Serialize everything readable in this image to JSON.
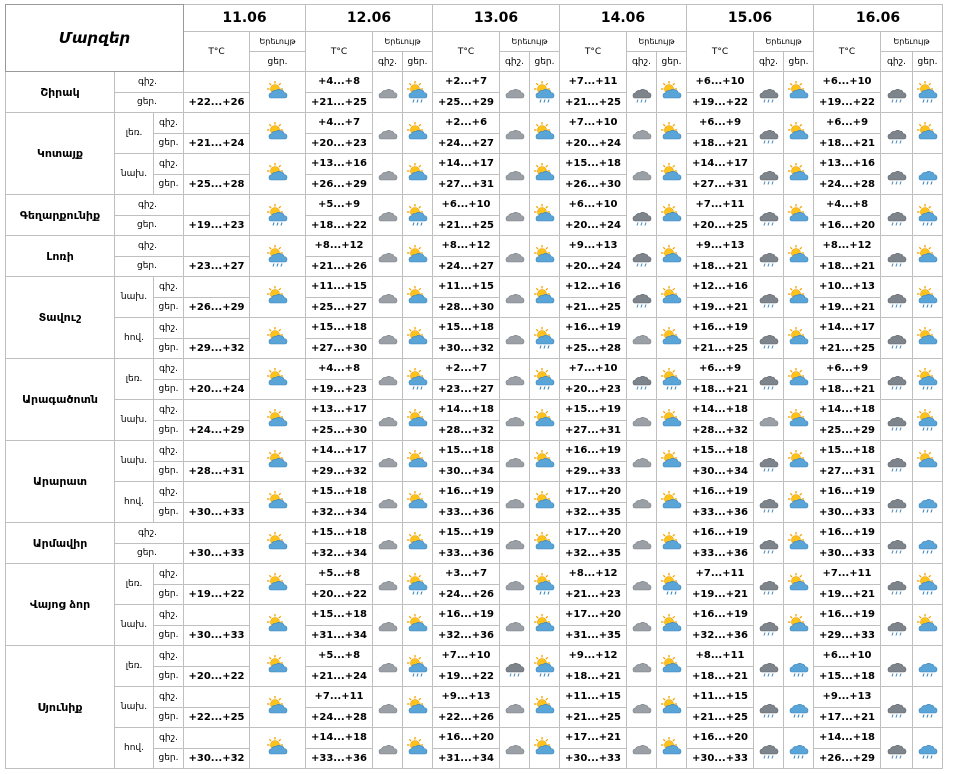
{
  "header": {
    "region_col": "Մարզեր",
    "temp_label": "T°C",
    "phen_label": "Երեւույթ",
    "night": "գիշ.",
    "day": "ցեր."
  },
  "days": [
    "11.06",
    "12.06",
    "13.06",
    "14.06",
    "15.06",
    "16.06"
  ],
  "regions": [
    {
      "name": "Շիրակ",
      "subs": [
        {
          "name": "",
          "nights": [
            "",
            "+4...+8",
            "+2...+7",
            "+7...+11",
            "+6...+10",
            "+6...+10"
          ],
          "days": [
            "+22...+26",
            "+21...+25",
            "+25...+29",
            "+21...+25",
            "+19...+22",
            "+19...+22"
          ]
        }
      ]
    },
    {
      "name": "Կոտայք",
      "subs": [
        {
          "name": "լեռ.",
          "nights": [
            "",
            "+4...+7",
            "+2...+6",
            "+7...+10",
            "+6...+9",
            "+6...+9"
          ],
          "days": [
            "+21...+24",
            "+20...+23",
            "+24...+27",
            "+20...+24",
            "+18...+21",
            "+18...+21"
          ]
        },
        {
          "name": "նախ.",
          "nights": [
            "",
            "+13...+16",
            "+14...+17",
            "+15...+18",
            "+14...+17",
            "+13...+16"
          ],
          "days": [
            "+25...+28",
            "+26...+29",
            "+27...+31",
            "+26...+30",
            "+27...+31",
            "+24...+28"
          ]
        }
      ]
    },
    {
      "name": "Գեղարքունիք",
      "subs": [
        {
          "name": "",
          "nights": [
            "",
            "+5...+9",
            "+6...+10",
            "+6...+10",
            "+7...+11",
            "+4...+8"
          ],
          "days": [
            "+19...+23",
            "+18...+22",
            "+21...+25",
            "+20...+24",
            "+20...+25",
            "+16...+20"
          ]
        }
      ]
    },
    {
      "name": "Լոռի",
      "subs": [
        {
          "name": "",
          "nights": [
            "",
            "+8...+12",
            "+8...+12",
            "+9...+13",
            "+9...+13",
            "+8...+12"
          ],
          "days": [
            "+23...+27",
            "+21...+26",
            "+24...+27",
            "+20...+24",
            "+18...+21",
            "+18...+21"
          ]
        }
      ]
    },
    {
      "name": "Տավուշ",
      "subs": [
        {
          "name": "նախ.",
          "nights": [
            "",
            "+11...+15",
            "+11...+15",
            "+12...+16",
            "+12...+16",
            "+10...+13"
          ],
          "days": [
            "+26...+29",
            "+25...+27",
            "+28...+30",
            "+21...+25",
            "+19...+21",
            "+19...+21"
          ]
        },
        {
          "name": "հով.",
          "nights": [
            "",
            "+15...+18",
            "+15...+18",
            "+16...+19",
            "+16...+19",
            "+14...+17"
          ],
          "days": [
            "+29...+32",
            "+27...+30",
            "+30...+32",
            "+25...+28",
            "+21...+25",
            "+21...+25"
          ]
        }
      ]
    },
    {
      "name": "Արագածոտն",
      "subs": [
        {
          "name": "լեռ.",
          "nights": [
            "",
            "+4...+8",
            "+2...+7",
            "+7...+10",
            "+6...+9",
            "+6...+9"
          ],
          "days": [
            "+20...+24",
            "+19...+23",
            "+23...+27",
            "+20...+23",
            "+18...+21",
            "+18...+21"
          ]
        },
        {
          "name": "նախ.",
          "nights": [
            "",
            "+13...+17",
            "+14...+18",
            "+15...+19",
            "+14...+18",
            "+14...+18"
          ],
          "days": [
            "+24...+29",
            "+25...+30",
            "+28...+32",
            "+27...+31",
            "+28...+32",
            "+25...+29"
          ]
        }
      ]
    },
    {
      "name": "Արարատ",
      "subs": [
        {
          "name": "նախ.",
          "nights": [
            "",
            "+14...+17",
            "+15...+18",
            "+16...+19",
            "+15...+18",
            "+15...+18"
          ],
          "days": [
            "+28...+31",
            "+29...+32",
            "+30...+34",
            "+29...+33",
            "+30...+34",
            "+27...+31"
          ]
        },
        {
          "name": "հով.",
          "nights": [
            "",
            "+15...+18",
            "+16...+19",
            "+17...+20",
            "+16...+19",
            "+16...+19"
          ],
          "days": [
            "+30...+33",
            "+32...+34",
            "+33...+36",
            "+32...+35",
            "+33...+36",
            "+30...+33"
          ]
        }
      ]
    },
    {
      "name": "Արմավիր",
      "subs": [
        {
          "name": "",
          "nights": [
            "",
            "+15...+18",
            "+15...+19",
            "+17...+20",
            "+16...+19",
            "+16...+19"
          ],
          "days": [
            "+30...+33",
            "+32...+34",
            "+33...+36",
            "+32...+35",
            "+33...+36",
            "+30...+33"
          ]
        }
      ]
    },
    {
      "name": "Վայոց ձոր",
      "subs": [
        {
          "name": "լեռ.",
          "nights": [
            "",
            "+5...+8",
            "+3...+7",
            "+8...+12",
            "+7...+11",
            "+7...+11"
          ],
          "days": [
            "+19...+22",
            "+20...+22",
            "+24...+26",
            "+21...+23",
            "+19...+21",
            "+19...+21"
          ]
        },
        {
          "name": "նախ.",
          "nights": [
            "",
            "+15...+18",
            "+16...+19",
            "+17...+20",
            "+16...+19",
            "+16...+19"
          ],
          "days": [
            "+30...+33",
            "+31...+34",
            "+32...+36",
            "+31...+35",
            "+32...+36",
            "+29...+33"
          ]
        }
      ]
    },
    {
      "name": "Սյունիք",
      "subs": [
        {
          "name": "լեռ.",
          "nights": [
            "",
            "+5...+8",
            "+7...+10",
            "+9...+12",
            "+8...+11",
            "+6...+10"
          ],
          "days": [
            "+20...+22",
            "+21...+24",
            "+19...+22",
            "+18...+21",
            "+18...+21",
            "+15...+18"
          ]
        },
        {
          "name": "նախ.",
          "nights": [
            "",
            "+7...+11",
            "+9...+13",
            "+11...+15",
            "+11...+15",
            "+9...+13"
          ],
          "days": [
            "+22...+25",
            "+24...+28",
            "+22...+26",
            "+21...+25",
            "+21...+25",
            "+17...+21"
          ]
        },
        {
          "name": "հով.",
          "nights": [
            "",
            "+14...+18",
            "+16...+20",
            "+17...+21",
            "+16...+20",
            "+14...+18"
          ],
          "days": [
            "+30...+32",
            "+33...+36",
            "+31...+34",
            "+30...+33",
            "+30...+33",
            "+26...+29"
          ]
        }
      ]
    }
  ],
  "icons": {
    "shirak": {
      "n": [
        "",
        "cloud",
        "cloud",
        "dark-cloud",
        "dark-cloud",
        "dark-cloud"
      ],
      "d": [
        "sun-cloud",
        "sun-cloud-rain",
        "sun-cloud-rain",
        "sun-cloud",
        "sun-cloud",
        "sun-cloud-rain"
      ],
      "n2": [
        "",
        "sun-cloud-rain",
        "sun-cloud-rain",
        "sun-cloud",
        "sun-cloud",
        "sun-cloud-rain"
      ]
    },
    "kotayk_mtn": {
      "n": [
        "",
        "cloud",
        "cloud",
        "cloud",
        "dark-cloud",
        "dark-cloud"
      ],
      "d": [
        "sun-cloud",
        "sun-cloud",
        "sun-cloud",
        "sun-cloud",
        "sun-cloud",
        "sun-cloud"
      ]
    },
    "kotayk_plain": {
      "n": [
        "",
        "cloud",
        "cloud",
        "cloud",
        "dark-cloud",
        "dark-cloud"
      ],
      "d": [
        "sun-cloud",
        "sun-cloud",
        "sun-cloud",
        "sun-cloud",
        "sun-cloud",
        "rain-cloud"
      ]
    },
    "gegh": {
      "n": [
        "",
        "cloud",
        "cloud",
        "dark-cloud",
        "dark-cloud",
        "dark-cloud"
      ],
      "d": [
        "sun-cloud-rain",
        "sun-cloud-rain",
        "sun-cloud",
        "sun-cloud",
        "sun-cloud",
        "sun-cloud-rain"
      ]
    },
    "lori": {
      "n": [
        "",
        "cloud",
        "cloud",
        "dark-cloud",
        "dark-cloud",
        "dark-cloud"
      ],
      "d": [
        "sun-cloud-rain",
        "sun-cloud",
        "sun-cloud",
        "sun-cloud",
        "sun-cloud",
        "sun-cloud"
      ]
    },
    "tavush_plain": {
      "n": [
        "",
        "cloud",
        "cloud",
        "dark-cloud",
        "dark-cloud",
        "dark-cloud"
      ],
      "d": [
        "sun-cloud",
        "sun-cloud",
        "sun-cloud",
        "sun-cloud",
        "sun-cloud",
        "sun-cloud-rain"
      ]
    },
    "tavush_val": {
      "n": [
        "",
        "cloud",
        "cloud",
        "cloud",
        "dark-cloud",
        "dark-cloud"
      ],
      "d": [
        "sun-cloud",
        "sun-cloud",
        "sun-cloud-rain",
        "sun-cloud",
        "sun-cloud",
        "sun-cloud"
      ]
    },
    "arag_mtn": {
      "n": [
        "",
        "cloud",
        "cloud",
        "dark-cloud",
        "dark-cloud",
        "dark-cloud"
      ],
      "d": [
        "sun-cloud",
        "sun-cloud-rain",
        "sun-cloud-rain",
        "sun-cloud-rain",
        "sun-cloud",
        "sun-cloud-rain"
      ]
    },
    "arag_plain": {
      "n": [
        "",
        "cloud",
        "cloud",
        "cloud",
        "cloud",
        "dark-cloud"
      ],
      "d": [
        "sun-cloud",
        "sun-cloud",
        "sun-cloud",
        "sun-cloud",
        "sun-cloud",
        "sun-cloud-rain"
      ]
    },
    "ararat_plain": {
      "n": [
        "",
        "cloud",
        "cloud",
        "cloud",
        "dark-cloud",
        "dark-cloud"
      ],
      "d": [
        "sun-cloud",
        "sun-cloud",
        "sun-cloud",
        "sun-cloud",
        "sun-cloud",
        "sun-cloud"
      ]
    },
    "ararat_val": {
      "n": [
        "",
        "cloud",
        "cloud",
        "cloud",
        "dark-cloud",
        "dark-cloud"
      ],
      "d": [
        "sun-cloud",
        "sun-cloud",
        "sun-cloud",
        "sun-cloud",
        "sun-cloud",
        "rain-cloud"
      ]
    },
    "armavir": {
      "n": [
        "",
        "cloud",
        "cloud",
        "cloud",
        "dark-cloud",
        "dark-cloud"
      ],
      "d": [
        "sun-cloud",
        "sun-cloud",
        "sun-cloud",
        "sun-cloud",
        "sun-cloud",
        "rain-cloud"
      ]
    },
    "vayots_mtn": {
      "n": [
        "",
        "cloud",
        "cloud",
        "cloud",
        "dark-cloud",
        "dark-cloud"
      ],
      "d": [
        "sun-cloud",
        "sun-cloud-rain",
        "sun-cloud-rain",
        "sun-cloud-rain",
        "sun-cloud",
        "sun-cloud-rain"
      ]
    },
    "vayots_plain": {
      "n": [
        "",
        "cloud",
        "cloud",
        "cloud",
        "dark-cloud",
        "dark-cloud"
      ],
      "d": [
        "sun-cloud",
        "sun-cloud",
        "sun-cloud",
        "sun-cloud",
        "sun-cloud",
        "sun-cloud"
      ]
    },
    "syunik_mtn": {
      "n": [
        "",
        "cloud",
        "dark-cloud",
        "cloud",
        "dark-cloud",
        "dark-cloud"
      ],
      "d": [
        "sun-cloud",
        "sun-cloud-rain",
        "sun-cloud-rain",
        "sun-cloud",
        "rain-cloud",
        "rain-cloud"
      ]
    },
    "syunik_plain": {
      "n": [
        "",
        "cloud",
        "cloud",
        "cloud",
        "dark-cloud",
        "dark-cloud"
      ],
      "d": [
        "sun-cloud",
        "sun-cloud",
        "sun-cloud",
        "sun-cloud",
        "rain-cloud",
        "rain-cloud"
      ]
    },
    "syunik_val": {
      "n": [
        "",
        "cloud",
        "cloud",
        "cloud",
        "dark-cloud",
        "dark-cloud"
      ],
      "d": [
        "sun-cloud",
        "sun-cloud",
        "sun-cloud",
        "sun-cloud",
        "rain-cloud",
        "rain-cloud"
      ]
    }
  },
  "icon_keys": [
    "shirak",
    "kotayk_mtn",
    "kotayk_plain",
    "gegh",
    "lori",
    "tavush_plain",
    "tavush_val",
    "arag_mtn",
    "arag_plain",
    "ararat_plain",
    "ararat_val",
    "armavir",
    "vayots_mtn",
    "vayots_plain",
    "syunik_mtn",
    "syunik_plain",
    "syunik_val"
  ]
}
